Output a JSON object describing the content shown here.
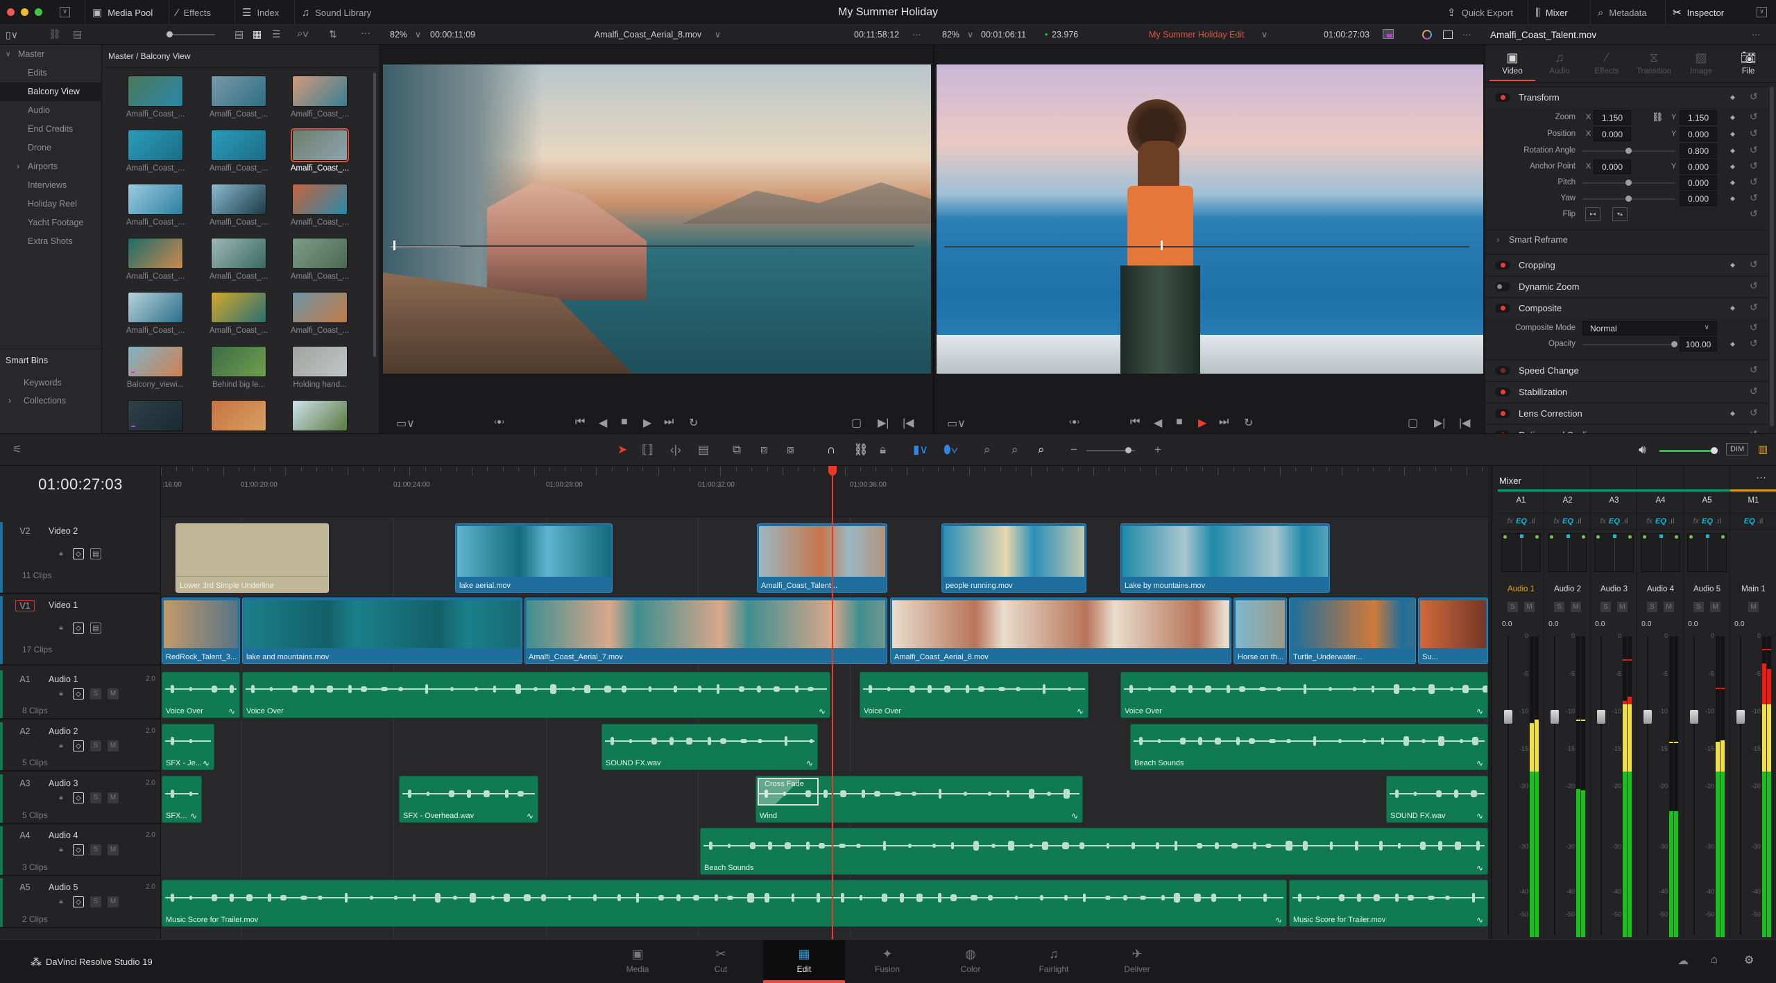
{
  "app": {
    "title": "My Summer Holiday",
    "product": "DaVinci Resolve Studio 19"
  },
  "topbar": {
    "left": [
      {
        "label": "Media Pool",
        "icon": "media-pool-icon"
      },
      {
        "label": "Effects",
        "icon": "effects-wand-icon"
      },
      {
        "label": "Index",
        "icon": "index-list-icon"
      },
      {
        "label": "Sound Library",
        "icon": "sound-library-icon"
      }
    ],
    "right": [
      {
        "label": "Quick Export",
        "icon": "export-icon"
      },
      {
        "label": "Mixer",
        "icon": "mixer-icon"
      },
      {
        "label": "Metadata",
        "icon": "metadata-icon"
      },
      {
        "label": "Inspector",
        "icon": "inspector-icon"
      }
    ]
  },
  "source_viewer": {
    "zoom": "82%",
    "timecode": "00:00:11:09",
    "clip_name": "Amalfi_Coast_Aerial_8.mov",
    "duration": "00:11:58:12",
    "scrub_position": 0.02
  },
  "timeline_viewer": {
    "zoom": "82%",
    "timecode": "00:01:06:11",
    "fps": "23.976",
    "timeline_name": "My Summer Holiday Edit",
    "record_timecode": "01:00:27:03",
    "scrub_position": 0.41,
    "name_color": "#e0513d"
  },
  "media_pool": {
    "breadcrumb": "Master / Balcony View",
    "bins": [
      {
        "label": "Master",
        "expanded": true
      },
      {
        "label": "Edits"
      },
      {
        "label": "Balcony View",
        "selected": true
      },
      {
        "label": "Audio"
      },
      {
        "label": "End Credits"
      },
      {
        "label": "Drone"
      },
      {
        "label": "Airports",
        "collapsed": true
      },
      {
        "label": "Interviews"
      },
      {
        "label": "Holiday Reel"
      },
      {
        "label": "Yacht Footage"
      },
      {
        "label": "Extra Shots"
      }
    ],
    "smart_bins_title": "Smart Bins",
    "smart_bins": [
      {
        "label": "Keywords"
      },
      {
        "label": "Collections",
        "collapsed": true
      }
    ],
    "clips": [
      {
        "label": "Amalfi_Coast_..."
      },
      {
        "label": "Amalfi_Coast_..."
      },
      {
        "label": "Amalfi_Coast_..."
      },
      {
        "label": "Amalfi_Coast_..."
      },
      {
        "label": "Amalfi_Coast_..."
      },
      {
        "label": "Amalfi_Coast_...",
        "selected": true
      },
      {
        "label": "Amalfi_Coast_..."
      },
      {
        "label": "Amalfi_Coast_..."
      },
      {
        "label": "Amalfi_Coast_..."
      },
      {
        "label": "Amalfi_Coast_..."
      },
      {
        "label": "Amalfi_Coast_..."
      },
      {
        "label": "Amalfi_Coast_..."
      },
      {
        "label": "Amalfi_Coast_..."
      },
      {
        "label": "Amalfi_Coast_..."
      },
      {
        "label": "Amalfi_Coast_..."
      },
      {
        "label": "Balcony_viewi...",
        "fx": "FX"
      },
      {
        "label": "Behind big le..."
      },
      {
        "label": "Holding hand..."
      },
      {
        "label": "",
        "fx": "FX"
      },
      {
        "label": ""
      },
      {
        "label": ""
      }
    ]
  },
  "inspector": {
    "clip_name": "Amalfi_Coast_Talent.mov",
    "tabs": [
      {
        "label": "Video",
        "icon": "film-icon",
        "active": true
      },
      {
        "label": "Audio",
        "icon": "music-note-icon"
      },
      {
        "label": "Effects",
        "icon": "effects-wand-icon"
      },
      {
        "label": "Transition",
        "icon": "transition-icon"
      },
      {
        "label": "Image",
        "icon": "image-icon"
      },
      {
        "label": "File",
        "icon": "camera-icon",
        "enabled": true
      }
    ],
    "transform": {
      "title": "Transform",
      "zoom": {
        "label": "Zoom",
        "x": "1.150",
        "y": "1.150"
      },
      "position": {
        "label": "Position",
        "x": "0.000",
        "y": "0.000"
      },
      "rotation": {
        "label": "Rotation Angle",
        "value": "0.800"
      },
      "anchor": {
        "label": "Anchor Point",
        "x": "0.000",
        "y": "0.000"
      },
      "pitch": {
        "label": "Pitch",
        "value": "0.000"
      },
      "yaw": {
        "label": "Yaw",
        "value": "0.000"
      },
      "flip": {
        "label": "Flip"
      },
      "x_label": "X",
      "y_label": "Y"
    },
    "smart_reframe": "Smart Reframe",
    "cropping": "Cropping",
    "dynamic_zoom": "Dynamic Zoom",
    "composite": {
      "title": "Composite",
      "mode_label": "Composite Mode",
      "mode_value": "Normal",
      "opacity_label": "Opacity",
      "opacity_value": "100.00"
    },
    "speed_change": "Speed Change",
    "stabilization": "Stabilization",
    "lens_correction": "Lens Correction",
    "retime": "Retime and Scaling"
  },
  "timeline": {
    "timecode": "01:00:27:03",
    "ruler": [
      ":16:00",
      "01:00:20:00",
      "01:00:24:00",
      "01:00:28:00",
      "01:00:32:00",
      "01:00:36:00"
    ],
    "tracks": [
      {
        "id": "V2",
        "name": "Video 2",
        "clips_count": "11 Clips",
        "clips": [
          {
            "label": "Lower 3rd Simple Underline"
          },
          {
            "label": "lake aerial.mov"
          },
          {
            "label": "Amalfi_Coast_Talent..."
          },
          {
            "label": "people running.mov"
          },
          {
            "label": "Lake by mountains.mov"
          }
        ]
      },
      {
        "id": "V1",
        "name": "Video 1",
        "clips_count": "17 Clips",
        "clips": [
          {
            "label": "RedRock_Talent_3..."
          },
          {
            "label": "lake and mountains.mov"
          },
          {
            "label": "Amalfi_Coast_Aerial_7.mov"
          },
          {
            "label": "Amalfi_Coast_Aerial_8.mov"
          },
          {
            "label": "Horse on th..."
          },
          {
            "label": "Turtle_Underwater..."
          },
          {
            "label": "Su..."
          }
        ]
      },
      {
        "id": "A1",
        "name": "Audio 1",
        "channels": "2.0",
        "clips_count": "8 Clips",
        "clips": [
          {
            "label": "Voice Over"
          },
          {
            "label": "Voice Over"
          },
          {
            "label": "Voice Over"
          },
          {
            "label": "Voice Over"
          }
        ]
      },
      {
        "id": "A2",
        "name": "Audio 2",
        "channels": "2.0",
        "clips_count": "5 Clips",
        "clips": [
          {
            "label": "SFX - Je..."
          },
          {
            "label": "SOUND FX.wav"
          },
          {
            "label": "Beach Sounds"
          }
        ]
      },
      {
        "id": "A3",
        "name": "Audio 3",
        "channels": "2.0",
        "clips_count": "5 Clips",
        "clips": [
          {
            "label": "SFX..."
          },
          {
            "label": "SFX - Overhead.wav"
          },
          {
            "label": "Wind",
            "transition": "Cross Fade"
          },
          {
            "label": "SOUND FX.wav"
          }
        ]
      },
      {
        "id": "A4",
        "name": "Audio 4",
        "channels": "2.0",
        "clips_count": "3 Clips",
        "clips": [
          {
            "label": "Beach Sounds"
          }
        ]
      },
      {
        "id": "A5",
        "name": "Audio 5",
        "channels": "2.0",
        "clips_count": "2 Clips",
        "clips": [
          {
            "label": "Music Score for Trailer.mov"
          },
          {
            "label": "Music Score for Trailer.mov"
          }
        ]
      }
    ],
    "button_labels": {
      "solo": "S",
      "mute": "M"
    },
    "dim_label": "DIM"
  },
  "mixer": {
    "title": "Mixer",
    "scale": [
      "0",
      "-5",
      "-10",
      "-15",
      "-20",
      "-30",
      "-40",
      "-50"
    ],
    "channels": [
      {
        "id": "A1",
        "name": "Audio 1",
        "gain": "0.0",
        "level_db": [
          -11.5,
          -11
        ],
        "peak_db": null,
        "active": true
      },
      {
        "id": "A2",
        "name": "Audio 2",
        "gain": "0.0",
        "level_db": [
          -20.3,
          -20.6
        ],
        "peak_db": -11
      },
      {
        "id": "A3",
        "name": "Audio 3",
        "gain": "0.0",
        "level_db": [
          -8.5,
          -8
        ],
        "peak_db": -3
      },
      {
        "id": "A4",
        "name": "Audio 4",
        "gain": "0.0",
        "level_db": [
          -24,
          -24
        ],
        "peak_db": -14
      },
      {
        "id": "A5",
        "name": "Audio 5",
        "gain": "0.0",
        "level_db": [
          -14,
          -13.8
        ],
        "peak_db": -6.8
      },
      {
        "id": "M1",
        "name": "Main 1",
        "gain": "0.0",
        "level_db": [
          -3.5,
          -4.3
        ],
        "peak_db": -1.6,
        "main": true
      }
    ],
    "fx_label": "fx",
    "eq_label": "EQ",
    "colors": {
      "track": "#0fa070",
      "main": "#e0a020",
      "meter_green": "#16c21a",
      "meter_yellow": "#f0e040",
      "meter_red": "#ee1c10"
    }
  },
  "pages": [
    {
      "label": "Media",
      "icon": "media-page-icon"
    },
    {
      "label": "Cut",
      "icon": "cut-page-icon"
    },
    {
      "label": "Edit",
      "icon": "edit-page-icon",
      "active": true
    },
    {
      "label": "Fusion",
      "icon": "fusion-page-icon"
    },
    {
      "label": "Color",
      "icon": "color-page-icon"
    },
    {
      "label": "Fairlight",
      "icon": "fairlight-page-icon"
    },
    {
      "label": "Deliver",
      "icon": "deliver-page-icon"
    }
  ],
  "colors": {
    "accent": "#e0513d",
    "video_clip": "#1f6f9e",
    "audio_clip": "#107a52",
    "title_clip": "#c0b698",
    "playhead": "#e8392a"
  }
}
